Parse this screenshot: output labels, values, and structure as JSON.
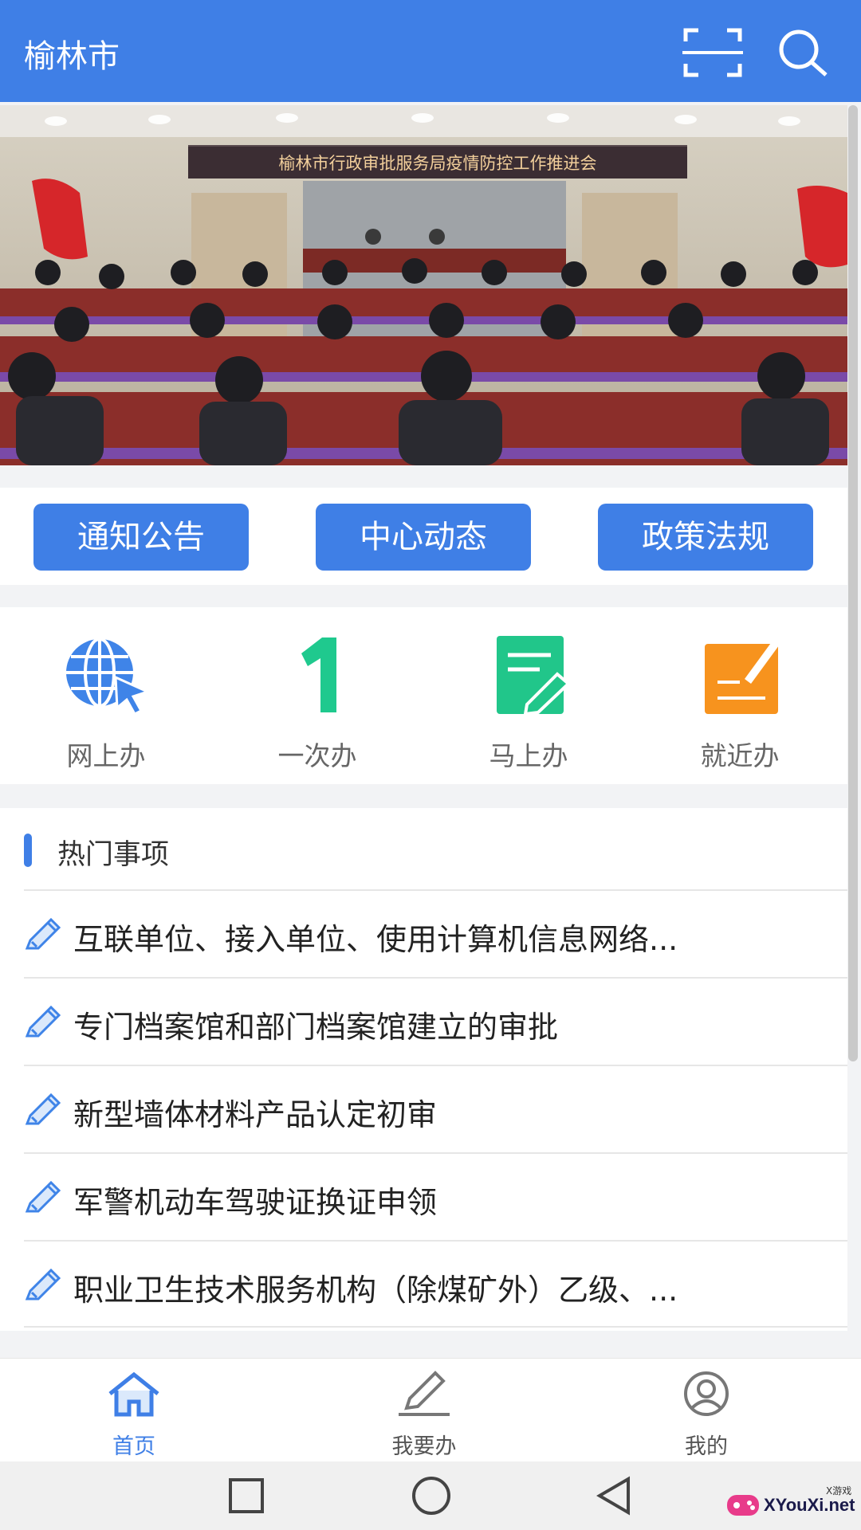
{
  "header": {
    "title": "榆林市",
    "scan_icon": "scan-icon",
    "search_icon": "search-icon"
  },
  "banner": {
    "sign_text": "榆林市行政审批服务局疫情防控工作推进会",
    "slide_count": 4,
    "active_slide": 1
  },
  "quick_links": [
    {
      "label": "通知公告"
    },
    {
      "label": "中心动态"
    },
    {
      "label": "政策法规"
    }
  ],
  "services": [
    {
      "label": "网上办",
      "icon": "globe-cursor-icon",
      "color": "#3f84e8"
    },
    {
      "label": "一次办",
      "icon": "number-one-icon",
      "color": "#1fc98e"
    },
    {
      "label": "马上办",
      "icon": "document-edit-icon",
      "color": "#21c68a"
    },
    {
      "label": "就近办",
      "icon": "note-pen-icon",
      "color": "#f7931e"
    }
  ],
  "hot_items": {
    "title": "热门事项",
    "items": [
      "互联单位、接入单位、使用计算机信息网络...",
      "专门档案馆和部门档案馆建立的审批",
      "新型墙体材料产品认定初审",
      "军警机动车驾驶证换证申领",
      "职业卫生技术服务机构（除煤矿外）乙级、..."
    ]
  },
  "tabbar": [
    {
      "label": "首页",
      "icon": "home-icon",
      "active": true
    },
    {
      "label": "我要办",
      "icon": "pencil-icon",
      "active": false
    },
    {
      "label": "我的",
      "icon": "user-icon",
      "active": false
    }
  ],
  "watermark": {
    "text": "XYouXi.net",
    "small_text": "X游戏"
  },
  "colors": {
    "primary": "#3f7fe6",
    "background": "#f2f3f5"
  }
}
